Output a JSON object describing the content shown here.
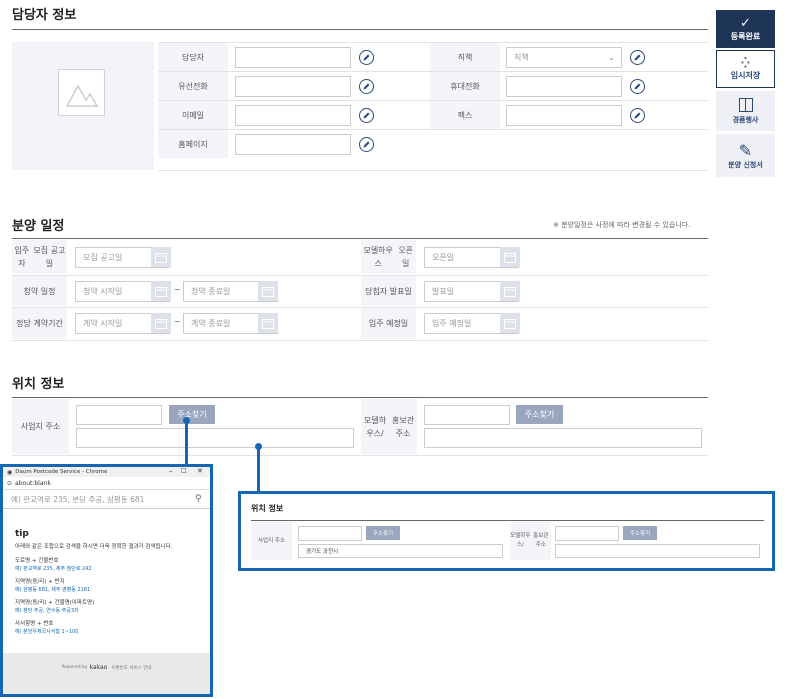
{
  "contact": {
    "title": "담당자 정보",
    "labels": {
      "person": "담당자",
      "position": "직책",
      "phone": "유선전화",
      "mobile": "휴대전화",
      "email": "이메일",
      "fax": "팩스",
      "homepage": "홈페이지"
    },
    "position_select": "직책"
  },
  "sidebar": {
    "done": "등록완료",
    "temp": "임시저장",
    "gift": "경품행사",
    "apply": "분양 신청서"
  },
  "schedule": {
    "title": "분양 일정",
    "note": "※ 분양일정은 사정에 따라 변경될 수 있습니다.",
    "recruit_label_1": "입주자",
    "recruit_label_2": "모집 공고일",
    "recruit_ph": "모집 공고일",
    "model_label_1": "모델하우스",
    "model_label_2": "오픈일",
    "model_ph": "오픈일",
    "apply_label": "청약 일정",
    "apply_start": "청약 시작일",
    "apply_end": "청약 종료일",
    "winner_label": "당첨자 발표일",
    "winner_ph": "발표일",
    "contract_label": "정당 계약기간",
    "contract_start": "계약 시작일",
    "contract_end": "계약 종료일",
    "movein_label": "입주 예정일",
    "movein_ph": "입주 예정일",
    "tilde": "~"
  },
  "location": {
    "title": "위치 정보",
    "site_label": "사업지 주소",
    "model_label_1": "모델하우스/",
    "model_label_2": "홍보관 주소",
    "search": "주소찾기"
  },
  "popup": {
    "window_title": "Daum Postcode Service - Chrome",
    "url": "about:blank",
    "search_ph": "예) 판교역로 235, 분당 주공, 삼평동 681",
    "tip_title": "tip",
    "tip_desc": "아래와 같은 조합으로 검색을 하시면 더욱 정확한 결과가 검색됩니다.",
    "tips": [
      {
        "h": "도로명 + 건물번호",
        "ex": "예) 판교역로 235, 제주 첨단로 242"
      },
      {
        "h": "지역명(동/리) + 번지",
        "ex": "예) 삼평동 681, 제주 영평동 2181"
      },
      {
        "h": "지역명(동/리) + 건물명(아파트명)",
        "ex": "예) 분당 주공, 연수동 주공3차"
      },
      {
        "h": "사서함명 + 번호",
        "ex": "예) 분당우체국사서함 1~100"
      }
    ],
    "powered": "Powered by",
    "kakao": "kakao",
    "guide": "우편번호 서비스 안내"
  },
  "zoom": {
    "title": "위치 정보",
    "site_label": "사업지 주소",
    "site_value": "경기도 과천시",
    "model_label_1": "모델하우스/",
    "model_label_2": "홍보관 주소",
    "search": "주소찾기"
  },
  "colors": {
    "accent": "#1566b5",
    "navy": "#1f3557",
    "button": "#9aa6bd"
  }
}
